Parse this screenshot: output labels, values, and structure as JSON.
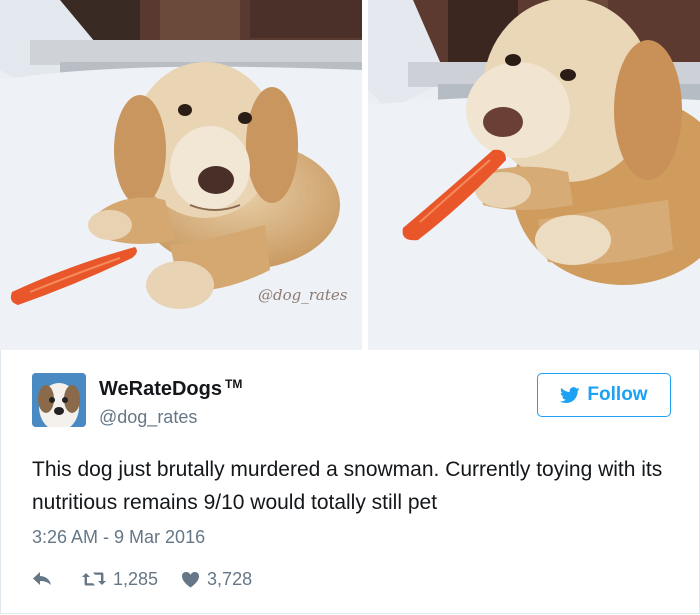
{
  "photos": {
    "watermark": "@dog_rates"
  },
  "tweet": {
    "display_name": "WeRateDogs",
    "tm": "TM",
    "handle": "@dog_rates",
    "follow_label": "Follow",
    "text": "This dog just brutally murdered a snowman. Currently toying with its nutritious remains 9/10 would totally still pet",
    "timestamp": "3:26 AM - 9 Mar 2016",
    "retweets": "1,285",
    "likes": "3,728"
  },
  "icons": {
    "follow": "twitter-bird-icon",
    "reply": "reply-icon",
    "retweet": "retweet-icon",
    "like": "heart-icon"
  },
  "colors": {
    "accent": "#1da1f2",
    "secondary_text": "#657786",
    "primary_text": "#14171a"
  }
}
